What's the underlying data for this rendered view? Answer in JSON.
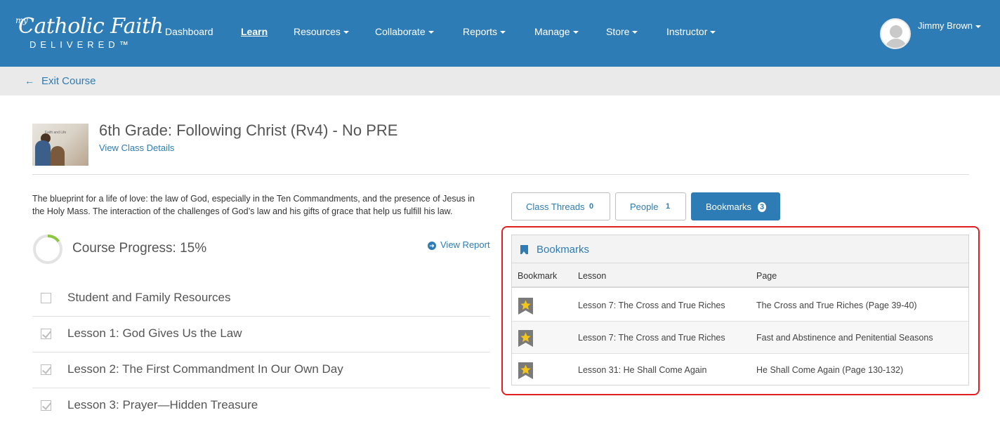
{
  "brand": {
    "logo_my": "my",
    "logo_main": "Catholic Faith",
    "logo_sub": "DELIVERED™"
  },
  "nav": {
    "items": [
      {
        "label": "Dashboard",
        "dropdown": false,
        "active": false
      },
      {
        "label": "Learn",
        "dropdown": false,
        "active": true
      },
      {
        "label": "Resources",
        "dropdown": true,
        "active": false
      },
      {
        "label": "Collaborate",
        "dropdown": true,
        "active": false
      },
      {
        "label": "Reports",
        "dropdown": true,
        "active": false
      },
      {
        "label": "Manage",
        "dropdown": true,
        "active": false
      },
      {
        "label": "Store",
        "dropdown": true,
        "active": false
      },
      {
        "label": "Instructor",
        "dropdown": true,
        "active": false
      }
    ],
    "user_name": "Jimmy Brown"
  },
  "exit": {
    "label": "Exit Course"
  },
  "course": {
    "thumb_text": "Faith and Life",
    "title": "6th Grade: Following Christ (Rv4) - No PRE",
    "view_details": "View Class Details",
    "description": "The blueprint for a life of love: the law of God, especially in the Ten Commandments, and the presence of Jesus in the Holy Mass. The interaction of the challenges of God’s law and his gifts of grace that help us fulfill his law.",
    "progress_label": "Course Progress: 15%",
    "progress_value": 15,
    "view_report": "View Report"
  },
  "lessons": [
    {
      "name": "Student and Family Resources",
      "checked": false
    },
    {
      "name": "Lesson 1: God Gives Us the Law",
      "checked": true
    },
    {
      "name": "Lesson 2: The First Commandment In Our Own Day",
      "checked": true
    },
    {
      "name": "Lesson 3: Prayer—Hidden Treasure",
      "checked": true
    }
  ],
  "tabs": [
    {
      "label": "Class Threads",
      "count": "0",
      "active": false
    },
    {
      "label": "People",
      "count": "1",
      "active": false
    },
    {
      "label": "Bookmarks",
      "count": "3",
      "active": true
    }
  ],
  "bookmarks": {
    "title": "Bookmarks",
    "columns": [
      "Bookmark",
      "Lesson",
      "Page"
    ],
    "rows": [
      {
        "lesson": "Lesson 7: The Cross and True Riches",
        "page": "The Cross and True Riches (Page 39-40)"
      },
      {
        "lesson": "Lesson 7: The Cross and True Riches",
        "page": "Fast and Abstinence and Penitential Seasons"
      },
      {
        "lesson": "Lesson 31: He Shall Come Again",
        "page": "He Shall Come Again (Page 130-132)"
      }
    ]
  },
  "colors": {
    "brand_blue": "#2e7cb5",
    "progress_green": "#8cc63f",
    "star_gold": "#f5c518",
    "highlight_red": "#e02020"
  },
  "icons": {
    "exit": "arrow-left-icon",
    "report": "circle-arrow-right-icon",
    "bookmark_header": "bookmark-icon",
    "bookmark_row": "star-icon"
  }
}
